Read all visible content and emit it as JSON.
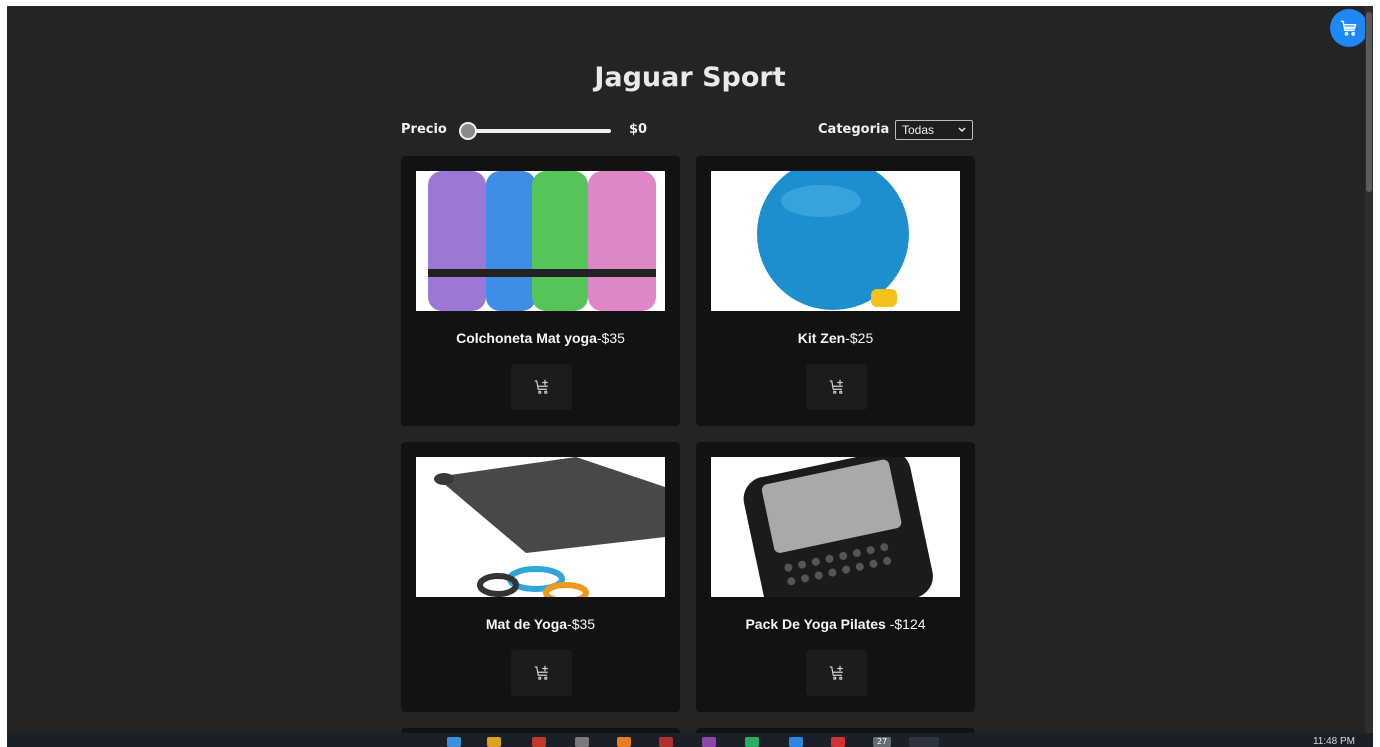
{
  "app": {
    "title": "Jaguar Sport"
  },
  "filters": {
    "price_label": "Precio",
    "price_value": "$0",
    "price_slider_fraction": 0,
    "category_label": "Categoria",
    "category_selected": "Todas"
  },
  "products": [
    {
      "name": "Colchoneta Mat yoga",
      "price": "-$35",
      "image_icon": "yoga-mats-image"
    },
    {
      "name": "Kit Zen",
      "price": "-$25",
      "image_icon": "fitness-ball-image"
    },
    {
      "name": "Mat de Yoga",
      "price": "-$35",
      "image_icon": "yoga-mat-bands-image"
    },
    {
      "name": "Pack De Yoga Pilates ",
      "price": "-$124",
      "image_icon": "phone-keyboard-image"
    }
  ],
  "icons": {
    "cart_fab": "cart-icon",
    "add_to_cart": "cart-plus-icon"
  },
  "colors": {
    "background": "#242424",
    "card": "#121212",
    "accent": "#1e88f5"
  },
  "taskbar": {
    "clock": "11:48 PM",
    "badge": "27"
  }
}
